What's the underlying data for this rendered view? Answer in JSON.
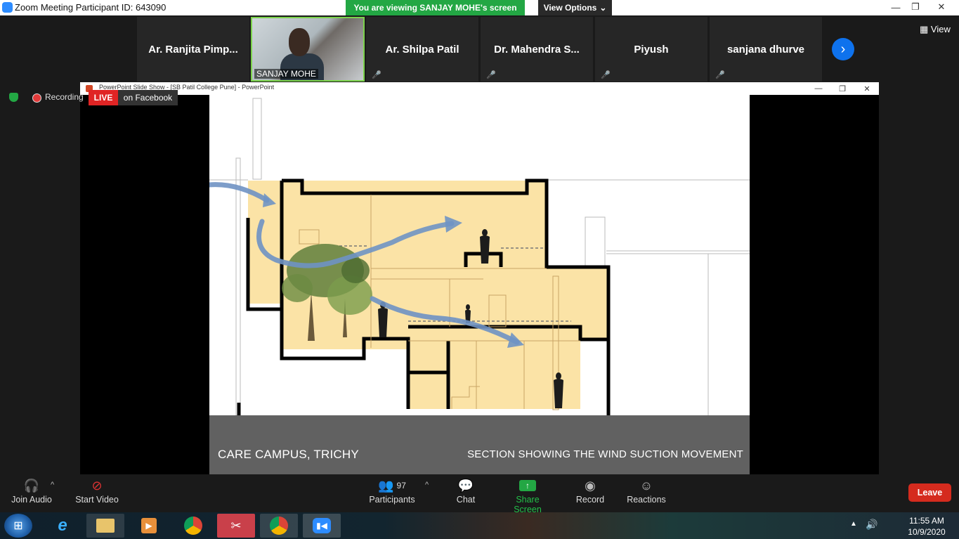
{
  "window": {
    "title": "Zoom Meeting Participant ID: 643090",
    "viewing_banner": "You are viewing SANJAY MOHE's screen",
    "view_options": "View Options"
  },
  "gallery": {
    "participants": [
      {
        "name": "Ar. Ranjita Pimp..."
      },
      {
        "name": "SANJAY MOHE"
      },
      {
        "name": "Ar. Shilpa Patil"
      },
      {
        "name": "Dr. Mahendra S..."
      },
      {
        "name": "Piyush"
      },
      {
        "name": "sanjana dhurve"
      }
    ],
    "view_label": "View"
  },
  "status": {
    "recording": "Recording",
    "live": "LIVE",
    "live_target": "on Facebook"
  },
  "ppt": {
    "window_title": "PowerPoint Slide Show - [SB Patil College Pune] - PowerPoint"
  },
  "slide": {
    "caption_left": "CARE CAMPUS, TRICHY",
    "caption_right": "SECTION SHOWING THE WIND SUCTION MOVEMENT",
    "colors": {
      "fill": "#fbe3a6",
      "ground": "#616161",
      "arrow": "#6f93c4"
    }
  },
  "toolbar": {
    "join_audio": "Join Audio",
    "start_video": "Start Video",
    "participants_count": "97",
    "participants": "Participants",
    "chat": "Chat",
    "share_screen": "Share Screen",
    "record": "Record",
    "reactions": "Reactions",
    "leave": "Leave"
  },
  "taskbar": {
    "time": "11:55 AM",
    "date": "10/9/2020"
  }
}
